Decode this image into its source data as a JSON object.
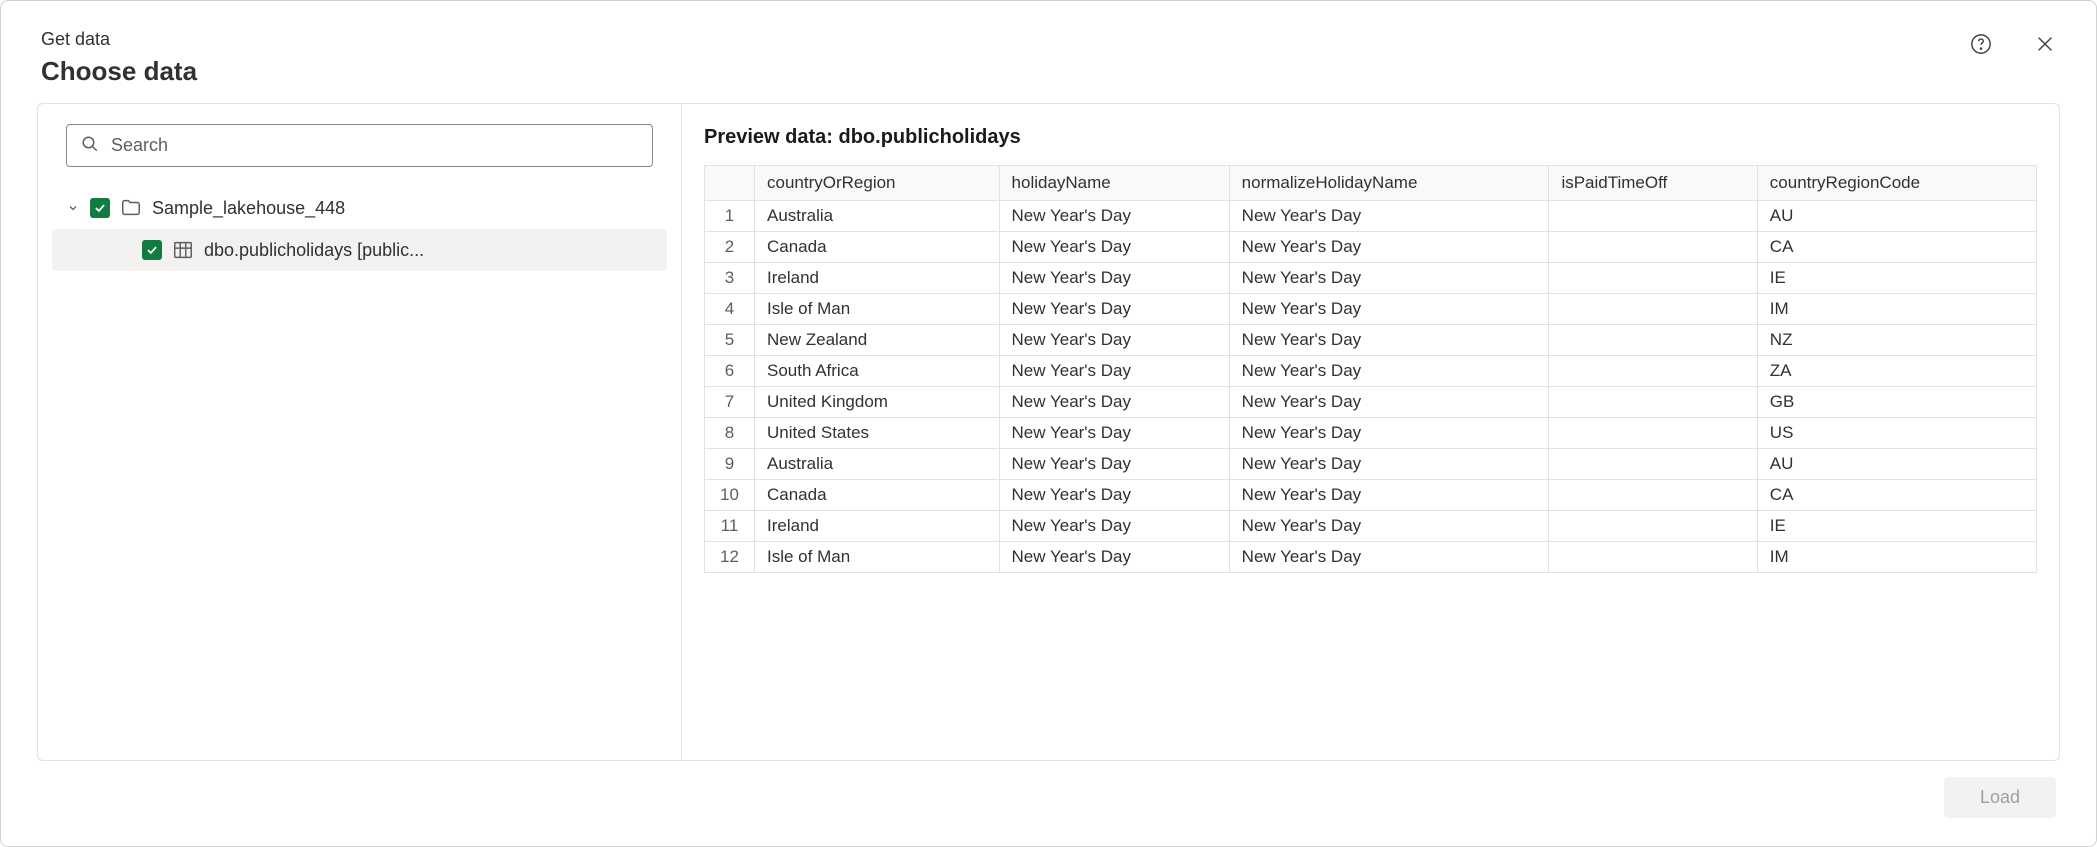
{
  "header": {
    "breadcrumb": "Get data",
    "title": "Choose data"
  },
  "search": {
    "placeholder": "Search",
    "value": ""
  },
  "tree": {
    "root": {
      "label": "Sample_lakehouse_448",
      "checked": true,
      "expanded": true
    },
    "child": {
      "label": "dbo.publicholidays [public...",
      "checked": true
    }
  },
  "preview": {
    "title": "Preview data: dbo.publicholidays",
    "columns": [
      "countryOrRegion",
      "holidayName",
      "normalizeHolidayName",
      "isPaidTimeOff",
      "countryRegionCode"
    ],
    "rows": [
      {
        "n": "1",
        "cells": [
          "Australia",
          "New Year's Day",
          "New Year's Day",
          "",
          "AU"
        ]
      },
      {
        "n": "2",
        "cells": [
          "Canada",
          "New Year's Day",
          "New Year's Day",
          "",
          "CA"
        ]
      },
      {
        "n": "3",
        "cells": [
          "Ireland",
          "New Year's Day",
          "New Year's Day",
          "",
          "IE"
        ]
      },
      {
        "n": "4",
        "cells": [
          "Isle of Man",
          "New Year's Day",
          "New Year's Day",
          "",
          "IM"
        ]
      },
      {
        "n": "5",
        "cells": [
          "New Zealand",
          "New Year's Day",
          "New Year's Day",
          "",
          "NZ"
        ]
      },
      {
        "n": "6",
        "cells": [
          "South Africa",
          "New Year's Day",
          "New Year's Day",
          "",
          "ZA"
        ]
      },
      {
        "n": "7",
        "cells": [
          "United Kingdom",
          "New Year's Day",
          "New Year's Day",
          "",
          "GB"
        ]
      },
      {
        "n": "8",
        "cells": [
          "United States",
          "New Year's Day",
          "New Year's Day",
          "",
          "US"
        ]
      },
      {
        "n": "9",
        "cells": [
          "Australia",
          "New Year's Day",
          "New Year's Day",
          "",
          "AU"
        ]
      },
      {
        "n": "10",
        "cells": [
          "Canada",
          "New Year's Day",
          "New Year's Day",
          "",
          "CA"
        ]
      },
      {
        "n": "11",
        "cells": [
          "Ireland",
          "New Year's Day",
          "New Year's Day",
          "",
          "IE"
        ]
      },
      {
        "n": "12",
        "cells": [
          "Isle of Man",
          "New Year's Day",
          "New Year's Day",
          "",
          "IM"
        ]
      }
    ]
  },
  "footer": {
    "load_label": "Load"
  }
}
